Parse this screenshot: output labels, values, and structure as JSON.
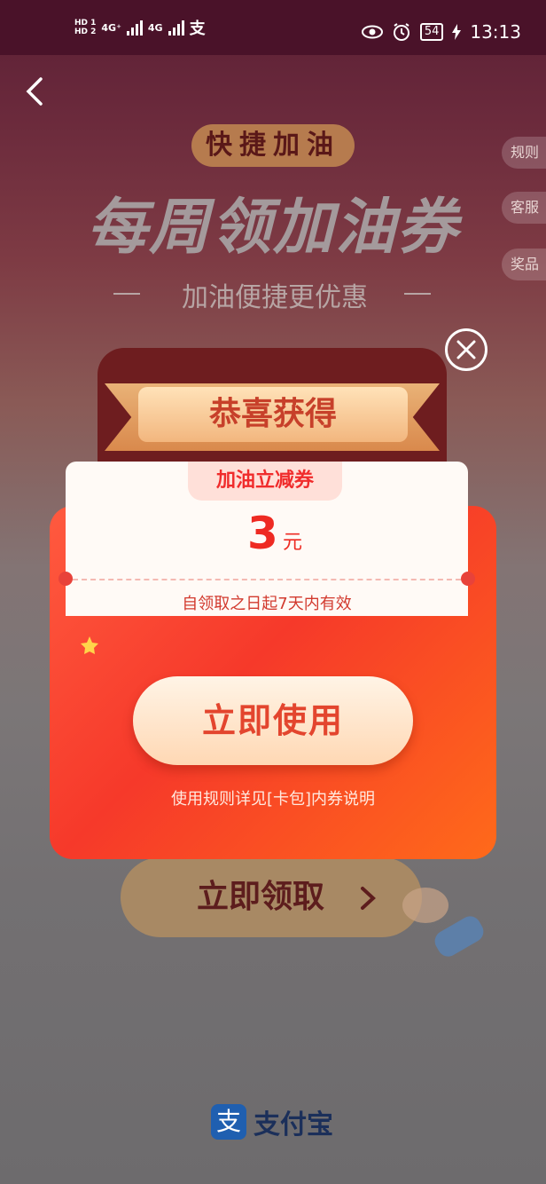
{
  "status_bar": {
    "hd1": "HD 1",
    "hd2": "HD 2",
    "net1": "4G⁺",
    "net2": "4G",
    "alipay_glyph": "支",
    "battery": "54",
    "time": "13:13"
  },
  "page": {
    "badge": "快捷加油",
    "title": "每周领加油券",
    "subtitle": "加油便捷更优惠",
    "side_buttons": [
      "规则",
      "客服",
      "奖品"
    ],
    "claim_button": "立即领取"
  },
  "popup": {
    "ribbon": "恭喜获得",
    "coupon_tag": "加油立减券",
    "amount": "3",
    "unit": "元",
    "validity": "自领取之日起7天内有效",
    "use_button": "立即使用",
    "rule_note": "使用规则详见[卡包]内券说明"
  },
  "footer": {
    "logo_glyph": "支",
    "brand": "支付宝"
  },
  "colors": {
    "accent_red": "#f6392a",
    "coupon_text": "#ee2a22",
    "alipay_blue": "#1f5fb0"
  },
  "icons": [
    "back-icon",
    "close-icon",
    "chevron-right-icon",
    "eye-icon",
    "alarm-icon",
    "charging-icon"
  ]
}
